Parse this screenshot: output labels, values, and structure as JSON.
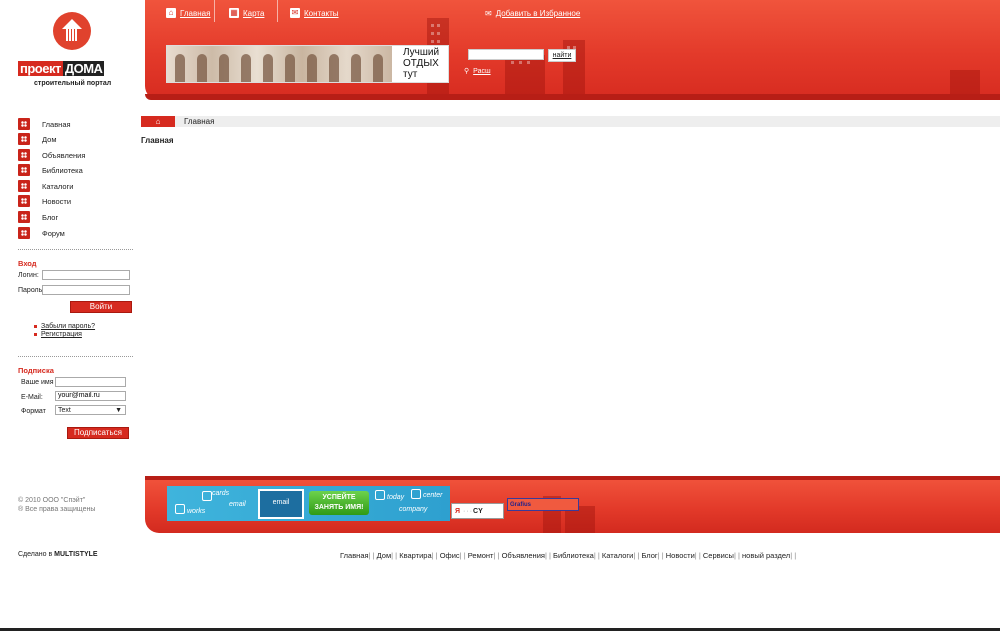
{
  "header": {
    "top_nav": [
      {
        "label": "Главная",
        "icon": "home-icon"
      },
      {
        "label": "Карта",
        "icon": "sitemap-icon"
      },
      {
        "label": "Контакты",
        "icon": "mail-icon"
      }
    ],
    "favorites_label": "Добавить в Избранное",
    "search": {
      "value": "",
      "button_label": "найти",
      "advanced_label": "Расш"
    },
    "banner_text": "Лучший ОТДЫХ тут"
  },
  "logo": {
    "part1": "проект",
    "part2": "ДОМА",
    "subtitle": "строительный портал"
  },
  "sidebar": {
    "menu": [
      {
        "label": "Главная"
      },
      {
        "label": "Дом"
      },
      {
        "label": "Объявления"
      },
      {
        "label": "Библиотека"
      },
      {
        "label": "Каталоги"
      },
      {
        "label": "Новости"
      },
      {
        "label": "Блог"
      },
      {
        "label": "Форум"
      }
    ],
    "login": {
      "title": "Вход",
      "login_label": "Логин:",
      "password_label": "Пароль:",
      "login_value": "",
      "password_value": "",
      "submit_label": "Войти",
      "forgot_label": "Забыли пароль?",
      "register_label": "Регистрация"
    },
    "subscribe": {
      "title": "Подписка",
      "name_label": "Ваше имя",
      "email_label": "E-Mail:",
      "email_value": "your@mail.ru",
      "format_label": "Формат",
      "format_value": "Text",
      "submit_label": "Подписаться"
    }
  },
  "main": {
    "breadcrumb": "Главная",
    "page_title": "Главная"
  },
  "footer": {
    "copyright_line1": "© 2010 ООО \"Спэйт\"",
    "copyright_line2": "® Все права защищены",
    "ad": {
      "words": [
        "cards",
        "email",
        "works",
        "today",
        "center",
        "company"
      ],
      "mail_label": "email",
      "cta_line1": "УСПЕЙТЕ",
      "cta_line2": "ЗАНЯТЬ ИМЯ!"
    },
    "counter1": {
      "ya": "Я",
      "cy": "CY"
    },
    "counter2": "Grafius",
    "made_by_prefix": "Сделано в",
    "made_by_brand": "MULTISTYLE",
    "bottom_links": [
      "Главная",
      "Дом",
      "Квартира",
      "Офис",
      "Ремонт",
      "Объявления",
      "Библиотека",
      "Каталоги",
      "Блог",
      "Новости",
      "Сервисы",
      "новый раздел"
    ]
  },
  "colors": {
    "accent": "#d62a1f",
    "header_light": "#f0543c"
  }
}
